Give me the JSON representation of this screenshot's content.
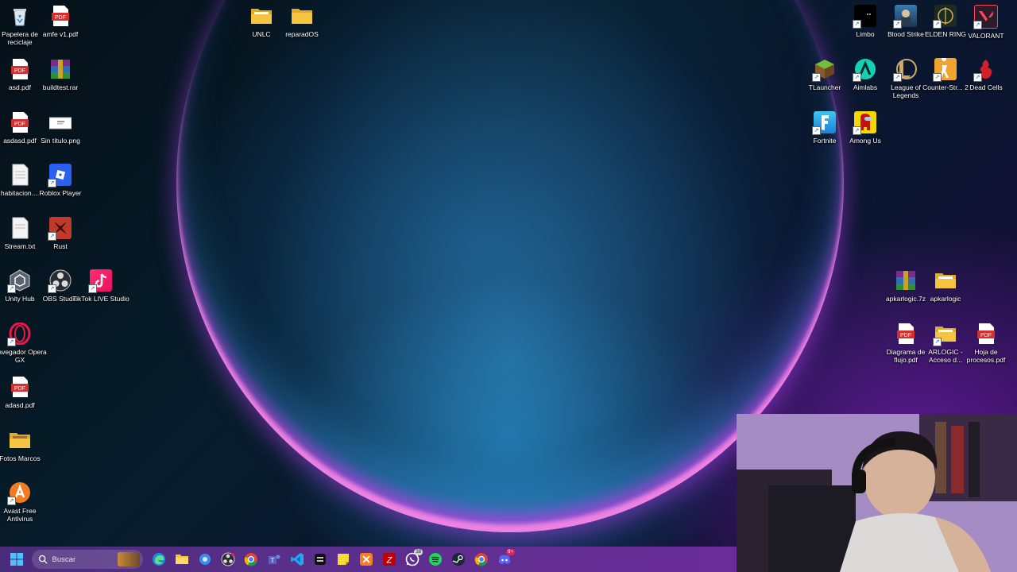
{
  "desktop": {
    "icons_left": [
      {
        "label": "Papelera de reciclaje",
        "icon": "recycle-bin-icon"
      },
      {
        "label": "amfe v1.pdf",
        "icon": "pdf-icon"
      },
      {
        "label": "asd.pdf",
        "icon": "pdf-icon"
      },
      {
        "label": "buildtest.rar",
        "icon": "winrar-icon"
      },
      {
        "label": "asdasd.pdf",
        "icon": "pdf-icon"
      },
      {
        "label": "Sin título.png",
        "icon": "image-file-icon"
      },
      {
        "label": "habitacion....",
        "icon": "text-file-icon"
      },
      {
        "label": "Roblox Player",
        "icon": "roblox-icon"
      },
      {
        "label": "Stream.txt",
        "icon": "text-file-icon"
      },
      {
        "label": "Rust",
        "icon": "rust-icon"
      },
      {
        "label": "Unity Hub",
        "icon": "unity-hub-icon"
      },
      {
        "label": "OBS Studio",
        "icon": "obs-icon"
      },
      {
        "label": "TikTok LIVE Studio",
        "icon": "tiktok-live-icon"
      },
      {
        "label": "Navegador Opera GX",
        "icon": "opera-gx-icon"
      },
      {
        "label": "adasd.pdf",
        "icon": "pdf-icon"
      },
      {
        "label": "Fotos Marcos",
        "icon": "folder-icon"
      },
      {
        "label": "Avast Free Antivirus",
        "icon": "avast-icon"
      }
    ],
    "icons_top": [
      {
        "label": "UNLC",
        "icon": "folder-icon"
      },
      {
        "label": "reparadOS",
        "icon": "folder-icon"
      }
    ],
    "icons_right": [
      {
        "label": "Limbo",
        "icon": "limbo-icon"
      },
      {
        "label": "Blood Strike",
        "icon": "blood-strike-icon"
      },
      {
        "label": "ELDEN RING",
        "icon": "elden-ring-icon"
      },
      {
        "label": "VALORANT",
        "icon": "valorant-icon"
      },
      {
        "label": "TLauncher",
        "icon": "tlauncher-icon"
      },
      {
        "label": "Aimlabs",
        "icon": "aimlabs-icon"
      },
      {
        "label": "League of Legends",
        "icon": "league-of-legends-icon"
      },
      {
        "label": "Counter-Str... 2",
        "icon": "counter-strike-icon"
      },
      {
        "label": "Dead Cells",
        "icon": "dead-cells-icon"
      },
      {
        "label": "Fortnite",
        "icon": "fortnite-icon"
      },
      {
        "label": "Among Us",
        "icon": "among-us-icon"
      },
      {
        "label": "apkarlogic.7z",
        "icon": "winrar-icon"
      },
      {
        "label": "apkarlogic",
        "icon": "folder-icon"
      },
      {
        "label": "Diagrama de flujo.pdf",
        "icon": "pdf-icon"
      },
      {
        "label": "ARLOGIC - Acceso d...",
        "icon": "folder-icon"
      },
      {
        "label": "Hoja de procesos.pdf",
        "icon": "pdf-icon"
      }
    ]
  },
  "taskbar": {
    "search_placeholder": "Buscar",
    "whatsapp_badge": "38",
    "discord_badge": "9+"
  },
  "colors": {
    "pdf_red": "#d32f2f",
    "folder_yellow": "#f5c542",
    "taskbar_purple": "#5a2f8a"
  }
}
